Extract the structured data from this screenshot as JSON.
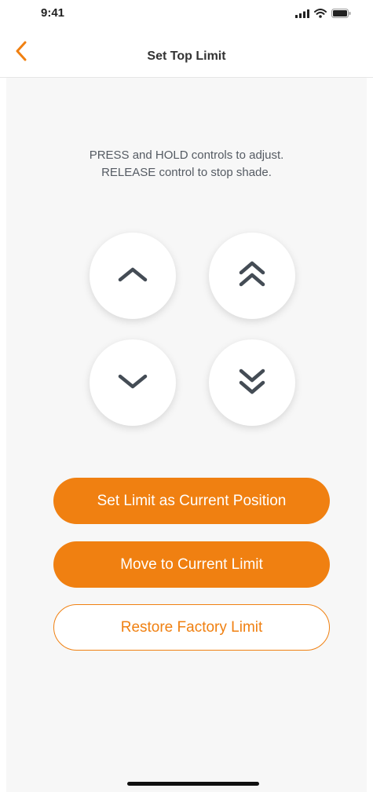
{
  "status_bar": {
    "time": "9:41",
    "icons": [
      "signal-icon",
      "wifi-icon",
      "battery-icon"
    ]
  },
  "nav": {
    "title": "Set Top Limit",
    "back_icon": "chevron-left-icon"
  },
  "instructions": {
    "line1": "PRESS and HOLD controls to adjust.",
    "line2": "RELEASE control to stop shade."
  },
  "controls": [
    {
      "name": "up-button",
      "icon": "chevron-up-icon"
    },
    {
      "name": "fast-up-button",
      "icon": "double-chevron-up-icon"
    },
    {
      "name": "down-button",
      "icon": "chevron-down-icon"
    },
    {
      "name": "fast-down-button",
      "icon": "double-chevron-down-icon"
    }
  ],
  "actions": {
    "set_limit": "Set Limit as Current Position",
    "move_to_limit": "Move to Current Limit",
    "restore_factory": "Restore Factory Limit"
  },
  "colors": {
    "accent": "#f08011",
    "icon": "#444c55",
    "background": "#f7f7f7"
  }
}
